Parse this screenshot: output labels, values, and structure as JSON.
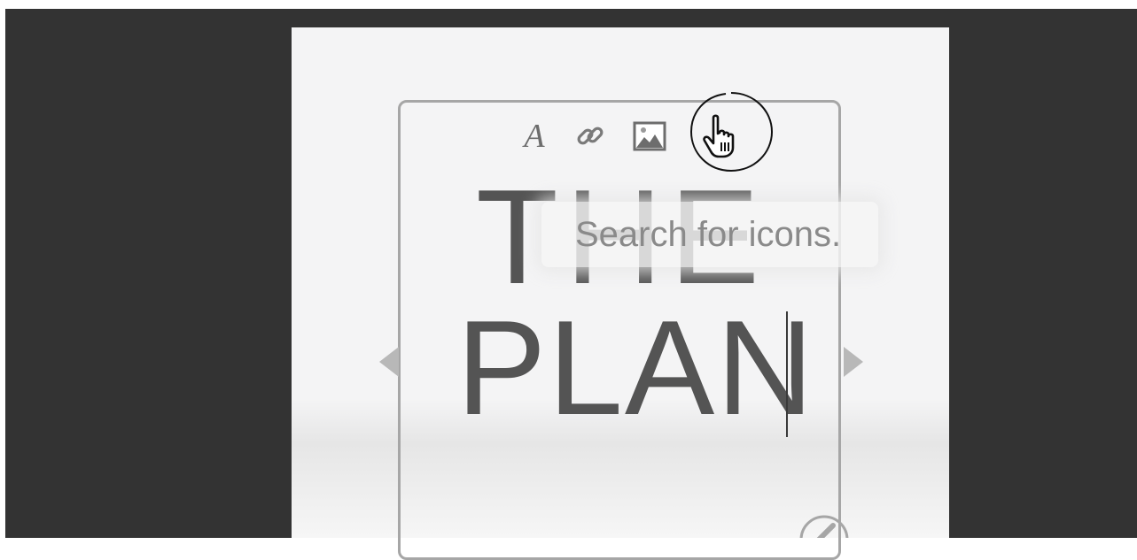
{
  "editor": {
    "headline_line1": "THE",
    "headline_line2": "PLAN",
    "tooltip_text": "Search for icons.",
    "text_tool_glyph": "A"
  },
  "toolbar": {
    "tools": [
      {
        "name": "text",
        "icon": "text-format-icon"
      },
      {
        "name": "link",
        "icon": "link-icon"
      },
      {
        "name": "image",
        "icon": "image-icon"
      },
      {
        "name": "icons",
        "icon": "hand-pointer-icon"
      }
    ]
  },
  "colors": {
    "outer_background": "#333333",
    "page_background": "#f4f4f5",
    "headline_text": "#545454",
    "card_border": "#a6a6a6",
    "tooltip_text": "#8a8a8a"
  }
}
